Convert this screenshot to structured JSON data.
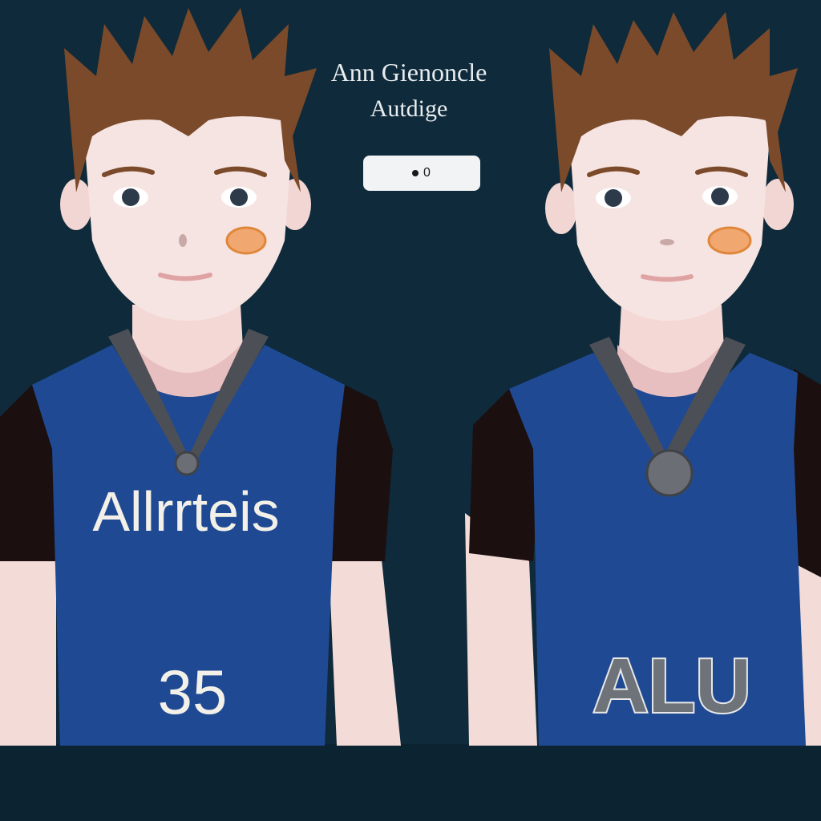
{
  "header": {
    "title_line1": "Ann Gienoncle",
    "title_line2": "Autdige",
    "badge_label": "0"
  },
  "players": [
    {
      "jersey_name": "Allrrteis",
      "jersey_number": "35"
    },
    {
      "jersey_front": "ALU"
    }
  ],
  "colors": {
    "background": "#0f2a3a",
    "jersey_blue": "#1f4a93",
    "hair_brown": "#7b4a2a",
    "skin": "#f6e2df"
  }
}
